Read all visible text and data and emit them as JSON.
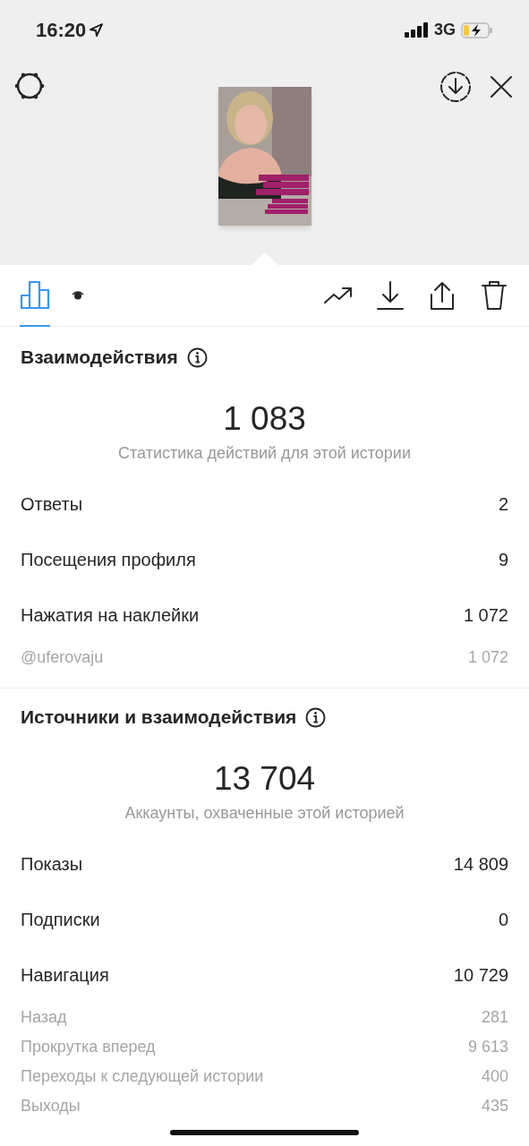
{
  "status_bar": {
    "time": "16:20",
    "network": "3G"
  },
  "tabs": [
    {
      "kind": "insights",
      "selected": true
    },
    {
      "kind": "viewers",
      "selected": false
    }
  ],
  "sections": [
    {
      "title": "Взаимодействия",
      "total": "1 083",
      "caption": "Статистика действий для этой истории",
      "rows": [
        {
          "kind": "main",
          "label": "Ответы",
          "value": "2"
        },
        {
          "kind": "main",
          "label": "Посещения профиля",
          "value": "9"
        },
        {
          "kind": "main",
          "label": "Нажатия на наклейки",
          "value": "1 072"
        },
        {
          "kind": "sub",
          "label": "@uferovaju",
          "value": "1 072"
        }
      ]
    },
    {
      "title": "Источники и взаимодействия",
      "total": "13 704",
      "caption": "Аккаунты, охваченные этой историей",
      "rows": [
        {
          "kind": "main",
          "label": "Показы",
          "value": "14 809"
        },
        {
          "kind": "main",
          "label": "Подписки",
          "value": "0"
        },
        {
          "kind": "main",
          "label": "Навигация",
          "value": "10 729"
        },
        {
          "kind": "sub",
          "label": "Назад",
          "value": "281"
        },
        {
          "kind": "sub",
          "label": "Прокрутка вперед",
          "value": "9 613"
        },
        {
          "kind": "sub",
          "label": "Переходы к следующей истории",
          "value": "400"
        },
        {
          "kind": "sub",
          "label": "Выходы",
          "value": "435"
        }
      ]
    }
  ]
}
